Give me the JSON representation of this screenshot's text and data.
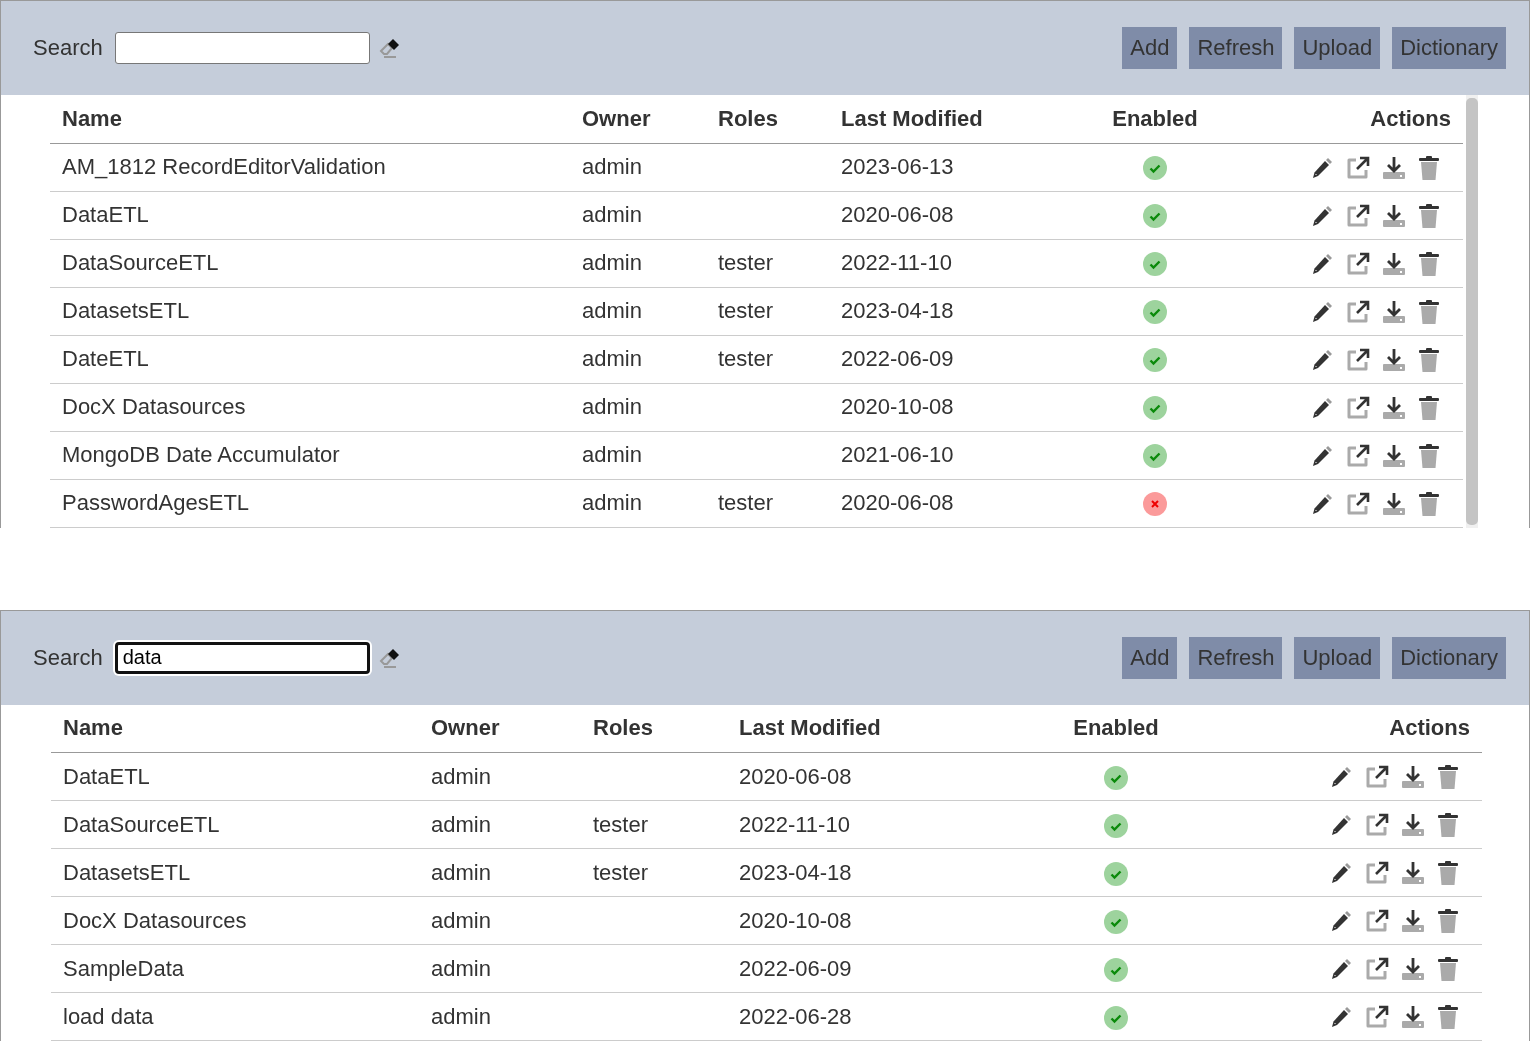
{
  "panels": [
    {
      "search": {
        "label": "Search",
        "focused": false
      },
      "buttons": [
        "Add",
        "Refresh",
        "Upload",
        "Dictionary"
      ],
      "scrollable": true,
      "columns": [
        "Name",
        "Owner",
        "Roles",
        "Last Modified",
        "Enabled",
        "Actions"
      ],
      "rows": [
        {
          "name": "AM_1812 RecordEditorValidation",
          "owner": "admin",
          "last_modified": "2023-06-13",
          "enabled": true
        },
        {
          "name": "DataETL",
          "owner": "admin",
          "last_modified": "2020-06-08",
          "enabled": true
        },
        {
          "name": "DataSourceETL",
          "owner": "admin",
          "roles": "tester",
          "last_modified": "2022-11-10",
          "enabled": true
        },
        {
          "name": "DatasetsETL",
          "owner": "admin",
          "roles": "tester",
          "last_modified": "2023-04-18",
          "enabled": true
        },
        {
          "name": "DateETL",
          "owner": "admin",
          "roles": "tester",
          "last_modified": "2022-06-09",
          "enabled": true
        },
        {
          "name": "DocX Datasources",
          "owner": "admin",
          "last_modified": "2020-10-08",
          "enabled": true
        },
        {
          "name": "MongoDB Date Accumulator",
          "owner": "admin",
          "last_modified": "2021-06-10",
          "enabled": true
        },
        {
          "name": "PasswordAgesETL",
          "owner": "admin",
          "roles": "tester",
          "last_modified": "2020-06-08",
          "enabled": false
        }
      ]
    },
    {
      "search": {
        "label": "Search",
        "value": "data",
        "focused": true
      },
      "buttons": [
        "Add",
        "Refresh",
        "Upload",
        "Dictionary"
      ],
      "scrollable": false,
      "columns": [
        "Name",
        "Owner",
        "Roles",
        "Last Modified",
        "Enabled",
        "Actions"
      ],
      "rows": [
        {
          "name": "DataETL",
          "owner": "admin",
          "last_modified": "2020-06-08",
          "enabled": true
        },
        {
          "name": "DataSourceETL",
          "owner": "admin",
          "roles": "tester",
          "last_modified": "2022-11-10",
          "enabled": true
        },
        {
          "name": "DatasetsETL",
          "owner": "admin",
          "roles": "tester",
          "last_modified": "2023-04-18",
          "enabled": true
        },
        {
          "name": "DocX Datasources",
          "owner": "admin",
          "last_modified": "2020-10-08",
          "enabled": true
        },
        {
          "name": "SampleData",
          "owner": "admin",
          "last_modified": "2022-06-09",
          "enabled": true
        },
        {
          "name": "load data",
          "owner": "admin",
          "last_modified": "2022-06-28",
          "enabled": true
        }
      ]
    }
  ]
}
